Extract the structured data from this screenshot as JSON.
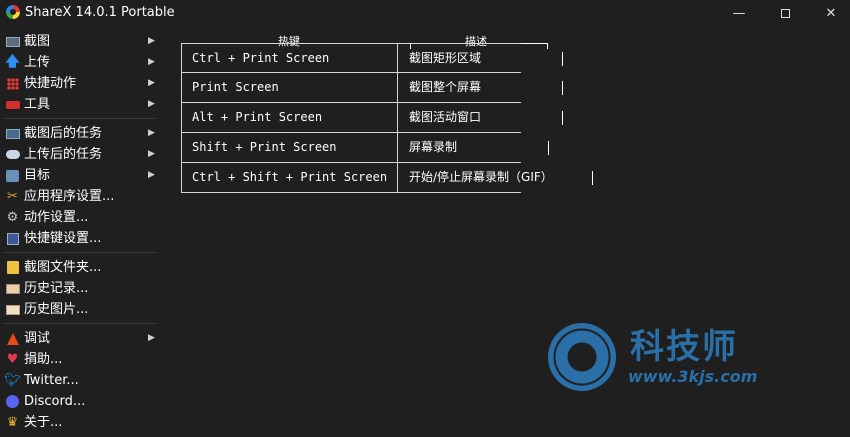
{
  "window": {
    "title": "ShareX 14.0.1 Portable",
    "minimize_glyph": "—",
    "close_glyph": "✕"
  },
  "sidebar": {
    "items": [
      {
        "label": "截图",
        "icon": "screen-icon",
        "submenu": true
      },
      {
        "label": "上传",
        "icon": "upload-icon",
        "submenu": true
      },
      {
        "label": "快捷动作",
        "icon": "dots-icon",
        "submenu": true
      },
      {
        "label": "工具",
        "icon": "toolbox-icon",
        "submenu": true
      },
      {
        "label": "截图后的任务",
        "icon": "monitor-icon",
        "submenu": true
      },
      {
        "label": "上传后的任务",
        "icon": "cloud-icon",
        "submenu": true
      },
      {
        "label": "目标",
        "icon": "target-icon",
        "submenu": true
      },
      {
        "label": "应用程序设置...",
        "icon": "wrench-icon",
        "submenu": false
      },
      {
        "label": "动作设置...",
        "icon": "gear-icon",
        "submenu": false
      },
      {
        "label": "快捷键设置...",
        "icon": "keyboard-icon",
        "submenu": false
      },
      {
        "label": "截图文件夹...",
        "icon": "folder-icon",
        "submenu": false
      },
      {
        "label": "历史记录...",
        "icon": "history-icon",
        "submenu": false
      },
      {
        "label": "历史图片...",
        "icon": "pictures-icon",
        "submenu": false
      },
      {
        "label": "调试",
        "icon": "debug-icon",
        "submenu": true
      },
      {
        "label": "捐助...",
        "icon": "heart-icon",
        "submenu": false
      },
      {
        "label": "Twitter...",
        "icon": "twitter-icon",
        "submenu": false
      },
      {
        "label": "Discord...",
        "icon": "discord-icon",
        "submenu": false
      },
      {
        "label": "关于...",
        "icon": "crown-icon",
        "submenu": false
      }
    ],
    "arrow_glyph": "▶"
  },
  "hotkeys": {
    "col_hotkey": "热键",
    "col_description": "描述",
    "rows": [
      {
        "key": "Ctrl + Print Screen",
        "desc": "截图矩形区域"
      },
      {
        "key": "Print Screen",
        "desc": "截图整个屏幕"
      },
      {
        "key": "Alt + Print Screen",
        "desc": "截图活动窗口"
      },
      {
        "key": "Shift + Print Screen",
        "desc": "屏幕录制"
      },
      {
        "key": "Ctrl + Shift + Print Screen",
        "desc": "开始/停止屏幕录制（GIF）"
      }
    ]
  },
  "watermark": {
    "name": "科技师",
    "url": "www.3kjs.com"
  },
  "colors": {
    "background": "#1f1f1f",
    "text": "#ffffff",
    "watermark": "#2a6fa8"
  }
}
